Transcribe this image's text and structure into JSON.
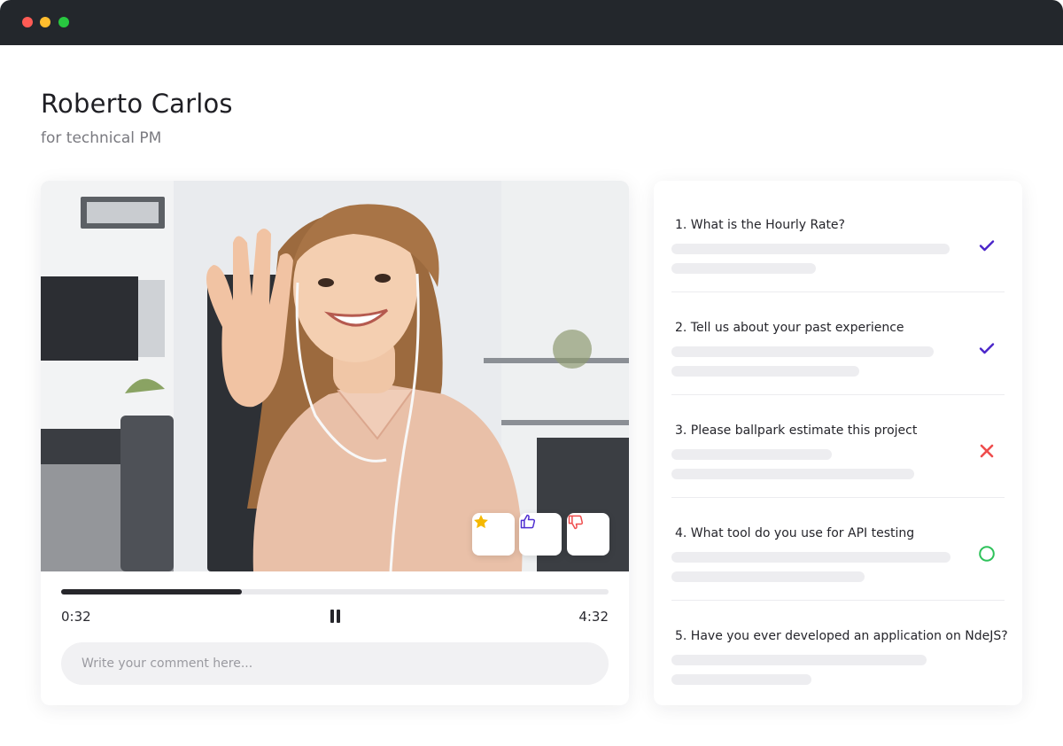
{
  "window": {
    "colors": {
      "titlebar": "#23272c",
      "close": "#ff5b55",
      "minimize": "#ffbd2e",
      "maximize": "#28c840"
    }
  },
  "header": {
    "title": "Roberto Carlos",
    "subtitle": "for technical PM"
  },
  "player": {
    "current_time": "0:32",
    "total_time": "4:32",
    "progress": 0.33,
    "state_icon": "pause-icon",
    "reactions": [
      {
        "icon": "star-icon",
        "color": "#f5b800"
      },
      {
        "icon": "thumbs-up-icon",
        "color": "#4f2fd1"
      },
      {
        "icon": "thumbs-down-icon",
        "color": "#ef4d4d"
      }
    ]
  },
  "comment": {
    "placeholder": "Write your comment here..."
  },
  "questions": {
    "items": [
      {
        "text": "1. What is the Hourly Rate?",
        "status": "answered",
        "icon": "check-icon"
      },
      {
        "text": "2. Tell us about your past experience",
        "status": "answered",
        "icon": "check-icon"
      },
      {
        "text": "3. Please ballpark estimate this project",
        "status": "rejected",
        "icon": "x-icon"
      },
      {
        "text": "4. What tool do you use for API testing",
        "status": "pending",
        "icon": "circle-icon"
      },
      {
        "text": "5. Have you ever developed an application on NdeJS?",
        "status": "none",
        "icon": ""
      }
    ],
    "colors": {
      "check": "#4a25c9",
      "x": "#ef4d4d",
      "circle": "#2ec25a"
    }
  }
}
